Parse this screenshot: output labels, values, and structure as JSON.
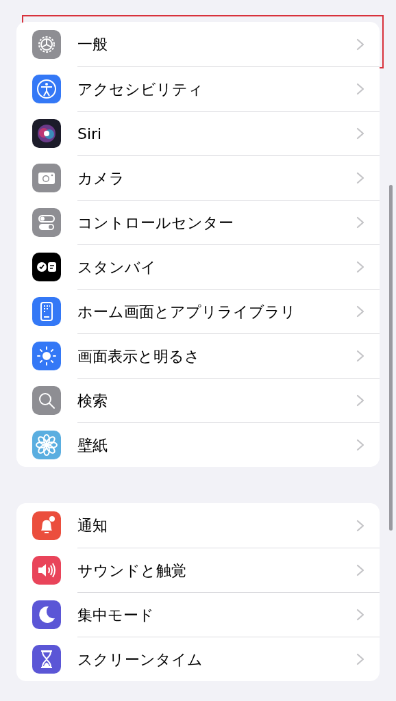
{
  "groups": [
    {
      "items": [
        {
          "label": "一般",
          "color": "#8e8e93",
          "highlighted": true
        },
        {
          "label": "アクセシビリティ",
          "color": "#3478f6",
          "highlighted": false
        },
        {
          "label": "Siri",
          "color": "#1c1c2a",
          "highlighted": false
        },
        {
          "label": "カメラ",
          "color": "#8e8e93",
          "highlighted": false
        },
        {
          "label": "コントロールセンター",
          "color": "#8e8e93",
          "highlighted": false
        },
        {
          "label": "スタンバイ",
          "color": "#000000",
          "highlighted": false
        },
        {
          "label": "ホーム画面とアプリライブラリ",
          "color": "#3478f6",
          "highlighted": false
        },
        {
          "label": "画面表示と明るさ",
          "color": "#3478f6",
          "highlighted": false
        },
        {
          "label": "検索",
          "color": "#8e8e93",
          "highlighted": false
        },
        {
          "label": "壁紙",
          "color": "#5aaee0",
          "highlighted": false
        }
      ]
    },
    {
      "items": [
        {
          "label": "通知",
          "color": "#eb4e3d",
          "highlighted": false
        },
        {
          "label": "サウンドと触覚",
          "color": "#e9445a",
          "highlighted": false
        },
        {
          "label": "集中モード",
          "color": "#5b56d6",
          "highlighted": false
        },
        {
          "label": "スクリーンタイム",
          "color": "#5b56d6",
          "highlighted": false
        }
      ]
    }
  ]
}
